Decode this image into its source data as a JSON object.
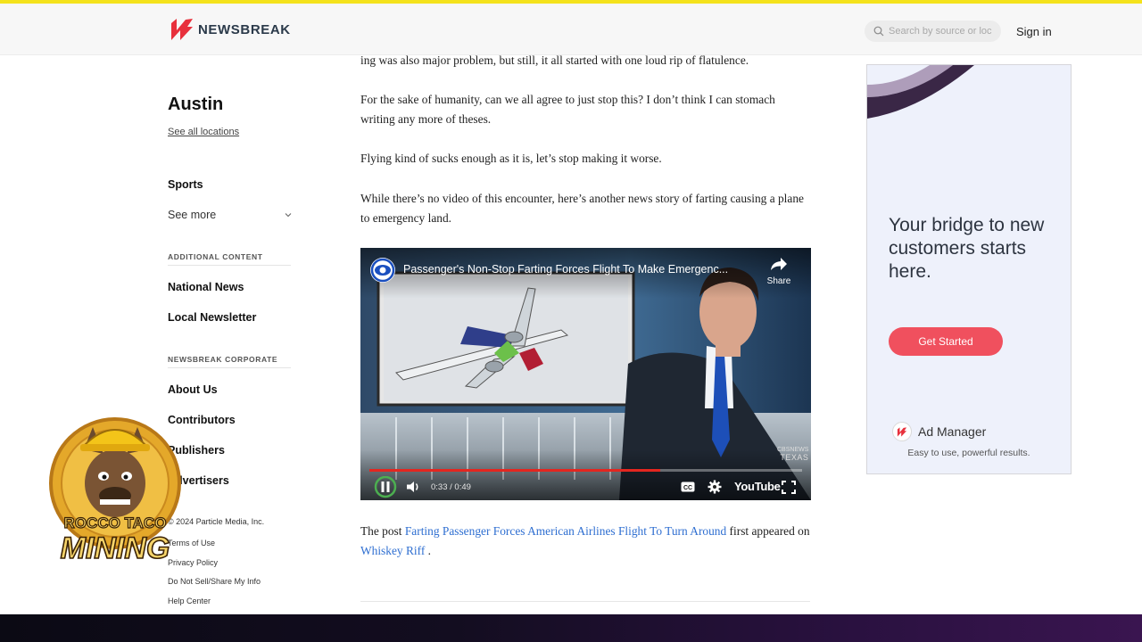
{
  "header": {
    "brand": "NEWSBREAK",
    "search_placeholder": "Search by source or loc",
    "signin_label": "Sign in",
    "accent_color": "#e8303c"
  },
  "sidebar": {
    "location": "Austin",
    "see_all": "See all locations",
    "items": [
      "Sports",
      "See more"
    ],
    "sections": [
      {
        "heading": "ADDITIONAL CONTENT",
        "items": [
          "National News",
          "Local Newsletter"
        ]
      },
      {
        "heading": "NEWSBREAK CORPORATE",
        "items": [
          "About Us",
          "Contributors",
          "Publishers",
          "Advertisers"
        ]
      }
    ],
    "footer": [
      "© 2024 Particle Media, Inc.",
      "Terms of Use",
      "Privacy Policy",
      "Do Not Sell/Share My Info",
      "Help Center"
    ]
  },
  "article": {
    "p1": "ing was also major problem, but still, it all started with one loud rip of flatulence.",
    "p2": "For the sake of humanity, can we all agree to just stop this? I don’t think I can stomach writing any more of theses.",
    "p3": "Flying kind of sucks enough as it is, let’s stop making it worse.",
    "p4": "While there’s no video of this encounter, here’s another news story of farting causing a plane to emergency land.",
    "outro_pre": "The post ",
    "outro_link": "Farting Passenger Forces American Airlines Flight To Turn Around",
    "outro_mid": " first appeared on ",
    "outro_source": "Whiskey Riff",
    "outro_end": " ."
  },
  "video": {
    "title": "Passenger's Non-Stop Farting Forces Flight To Make Emergenc...",
    "share_label": "Share",
    "time": "0:33 / 0:49",
    "progress": 0.673,
    "platform": "YouTube",
    "cc_label": "CC",
    "channel_tag_small": "CBSNEWS",
    "channel_tag": "TEXAS"
  },
  "ad": {
    "headline": "Your bridge to new customers starts here.",
    "cta": "Get Started",
    "product": "Ad Manager",
    "tagline": "Easy to use, powerful results."
  },
  "watermark": {
    "line1": "ROCCO TACO",
    "line2": "MINING"
  }
}
